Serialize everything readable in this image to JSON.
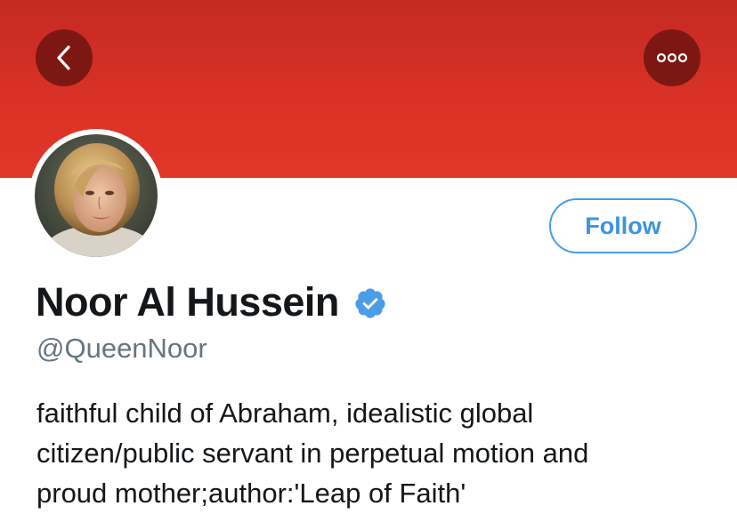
{
  "header": {
    "back_icon": "chevron-left-icon",
    "more_icon": "ellipsis-icon",
    "banner_color": "#d93225"
  },
  "profile": {
    "display_name": "Noor Al Hussein",
    "handle": "@QueenNoor",
    "verified": true,
    "verified_color": "#4a9de6",
    "bio_lines": [
      "faithful child of Abraham, idealistic global",
      "citizen/public servant in perpetual motion and",
      "proud mother;author:'Leap of Faith'"
    ]
  },
  "actions": {
    "follow_label": "Follow",
    "accent_color": "#3d94e0"
  }
}
